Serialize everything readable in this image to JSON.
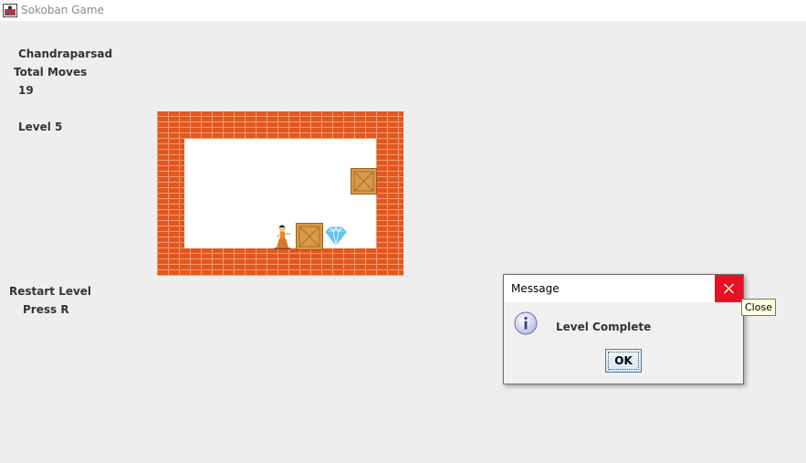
{
  "window": {
    "title": "Sokoban Game",
    "icon": "sokoban-app-icon"
  },
  "sidebar": {
    "player_name": "Chandraparsad",
    "moves_label": "Total Moves",
    "moves_value": "19",
    "level_label": "Level 5",
    "restart_label": "Restart Level",
    "restart_key": "Press R"
  },
  "board": {
    "wall_color": "#e2571e",
    "floor_color": "#ffffff",
    "box_color": "#d79a48",
    "tiles": [
      "brick-wall",
      "floor",
      "wooden-box",
      "player",
      "diamond-goal"
    ]
  },
  "dialog": {
    "title": "Message",
    "message": "Level Complete",
    "ok_label": "OK",
    "icon": "info-icon",
    "close_color": "#e81123",
    "tooltip": "Close"
  }
}
